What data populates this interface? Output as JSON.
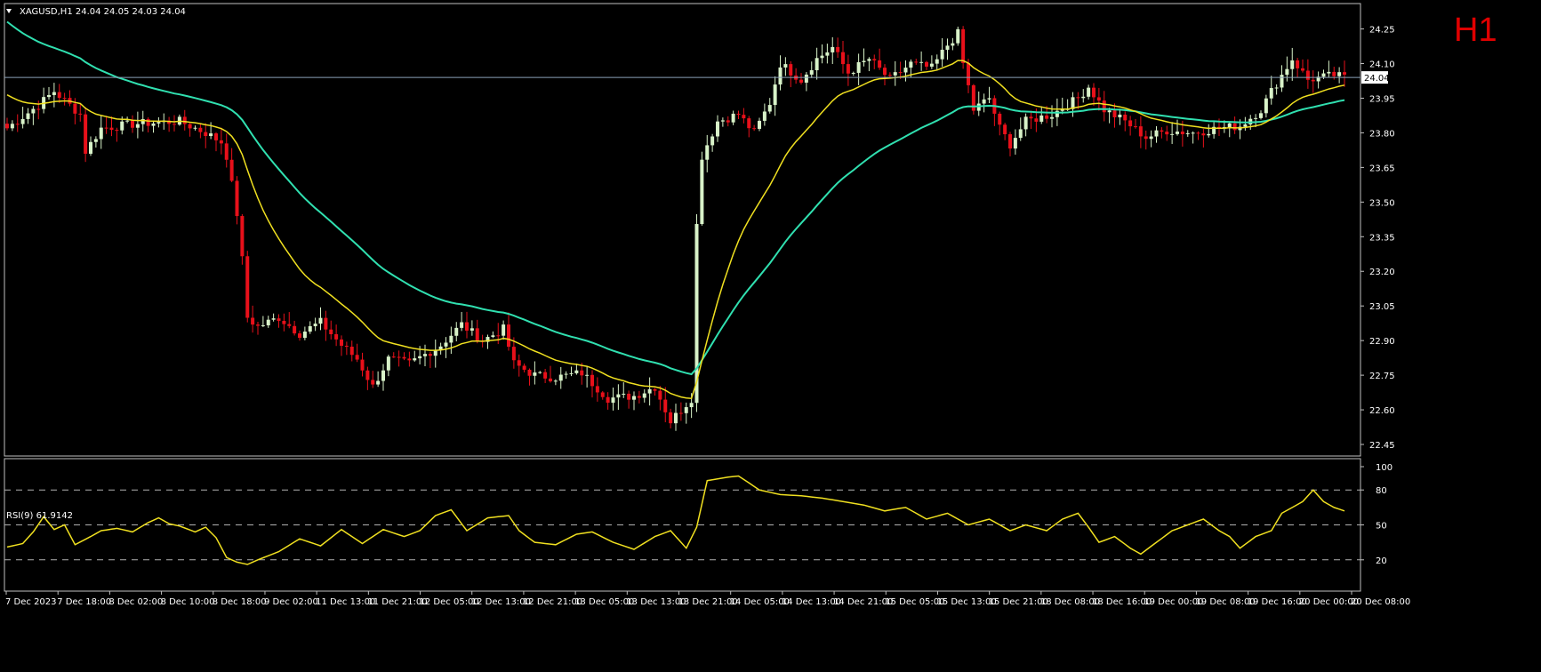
{
  "header": {
    "symbol_line": "XAGUSD,H1  24.04 24.05 24.03 24.04",
    "timeframe": "H1"
  },
  "colors": {
    "background": "#000000",
    "frame": "#c0c0c0",
    "bull_body": "#d8f2c8",
    "bear_body": "#e8101a",
    "ema_fast": "#f0e020",
    "ema_slow": "#30e0b0",
    "rsi_line": "#f0e020",
    "price_line": "#8aa0b8"
  },
  "chart_data": [
    {
      "type": "candlestick",
      "title": "XAGUSD,H1",
      "ylim": [
        22.4,
        24.36
      ],
      "y_ticks": [
        24.25,
        24.1,
        23.95,
        23.8,
        23.65,
        23.5,
        23.35,
        23.2,
        23.05,
        22.9,
        22.75,
        22.6,
        22.45
      ],
      "y_tick_labels": [
        "24.25",
        "24.10",
        "23.95",
        "23.80",
        "23.65",
        "23.50",
        "23.35",
        "23.20",
        "23.05",
        "22.90",
        "22.75",
        "22.60",
        "22.45"
      ],
      "current_price": 24.04,
      "current_price_label": "24.04",
      "x_labels": [
        "7 Dec 2023",
        "7 Dec 18:00",
        "8 Dec 02:00",
        "8 Dec 10:00",
        "8 Dec 18:00",
        "9 Dec 02:00",
        "11 Dec 13:00",
        "11 Dec 21:00",
        "12 Dec 05:00",
        "12 Dec 13:00",
        "12 Dec 21:00",
        "13 Dec 05:00",
        "13 Dec 13:00",
        "13 Dec 21:00",
        "14 Dec 05:00",
        "14 Dec 13:00",
        "14 Dec 21:00",
        "15 Dec 05:00",
        "15 Dec 13:00",
        "15 Dec 21:00",
        "18 Dec 08:00",
        "18 Dec 16:00",
        "19 Dec 00:00",
        "19 Dec 08:00",
        "19 Dec 16:00",
        "20 Dec 00:00",
        "20 Dec 08:00"
      ],
      "key_points": [
        [
          0,
          23.82
        ],
        [
          6,
          23.92
        ],
        [
          9,
          23.98
        ],
        [
          14,
          23.88
        ],
        [
          15,
          23.72
        ],
        [
          18,
          23.82
        ],
        [
          25,
          23.84
        ],
        [
          33,
          23.85
        ],
        [
          38,
          23.8
        ],
        [
          41,
          23.76
        ],
        [
          42,
          23.7
        ],
        [
          44,
          23.45
        ],
        [
          45,
          23.25
        ],
        [
          46,
          23.0
        ],
        [
          48,
          22.96
        ],
        [
          52,
          23.0
        ],
        [
          56,
          22.93
        ],
        [
          60,
          22.98
        ],
        [
          64,
          22.88
        ],
        [
          67,
          22.82
        ],
        [
          70,
          22.7
        ],
        [
          73,
          22.82
        ],
        [
          77,
          22.8
        ],
        [
          83,
          22.88
        ],
        [
          87,
          22.97
        ],
        [
          91,
          22.9
        ],
        [
          95,
          22.95
        ],
        [
          97,
          22.8
        ],
        [
          101,
          22.75
        ],
        [
          105,
          22.74
        ],
        [
          110,
          22.76
        ],
        [
          115,
          22.65
        ],
        [
          120,
          22.66
        ],
        [
          124,
          22.7
        ],
        [
          127,
          22.55
        ],
        [
          129,
          22.6
        ],
        [
          131,
          22.65
        ],
        [
          132,
          23.4
        ],
        [
          133,
          23.7
        ],
        [
          136,
          23.85
        ],
        [
          140,
          23.88
        ],
        [
          143,
          23.8
        ],
        [
          146,
          23.93
        ],
        [
          148,
          24.1
        ],
        [
          152,
          24.03
        ],
        [
          155,
          24.12
        ],
        [
          158,
          24.17
        ],
        [
          161,
          24.06
        ],
        [
          165,
          24.12
        ],
        [
          169,
          24.03
        ],
        [
          173,
          24.1
        ],
        [
          177,
          24.08
        ],
        [
          180,
          24.18
        ],
        [
          182,
          24.23
        ],
        [
          183,
          24.1
        ],
        [
          185,
          23.9
        ],
        [
          188,
          23.95
        ],
        [
          190,
          23.82
        ],
        [
          192,
          23.75
        ],
        [
          195,
          23.85
        ],
        [
          200,
          23.88
        ],
        [
          205,
          23.95
        ],
        [
          207,
          24.0
        ],
        [
          210,
          23.9
        ],
        [
          214,
          23.85
        ],
        [
          218,
          23.78
        ],
        [
          222,
          23.81
        ],
        [
          227,
          23.8
        ],
        [
          232,
          23.82
        ],
        [
          236,
          23.83
        ],
        [
          240,
          23.9
        ],
        [
          242,
          23.98
        ],
        [
          244,
          24.05
        ],
        [
          246,
          24.12
        ],
        [
          249,
          24.03
        ],
        [
          254,
          24.05
        ],
        [
          256,
          24.04
        ]
      ],
      "ema_fast": {
        "period": 20
      },
      "ema_slow": {
        "period": 50
      }
    },
    {
      "type": "line",
      "title": "RSI(9) 61.9142",
      "ylim": [
        0,
        100
      ],
      "y_ticks": [
        100,
        80,
        50,
        20
      ],
      "y_tick_labels": [
        "100",
        "80",
        "50",
        "20"
      ],
      "levels": [
        80,
        50,
        20
      ],
      "key_points": [
        [
          0,
          31
        ],
        [
          3,
          34
        ],
        [
          5,
          44
        ],
        [
          7,
          57
        ],
        [
          9,
          46
        ],
        [
          11,
          50
        ],
        [
          13,
          33
        ],
        [
          16,
          40
        ],
        [
          18,
          45
        ],
        [
          21,
          47
        ],
        [
          24,
          44
        ],
        [
          27,
          52
        ],
        [
          29,
          56
        ],
        [
          31,
          51
        ],
        [
          33,
          49
        ],
        [
          36,
          44
        ],
        [
          38,
          48
        ],
        [
          40,
          39
        ],
        [
          42,
          22
        ],
        [
          44,
          18
        ],
        [
          46,
          16
        ],
        [
          48,
          20
        ],
        [
          52,
          27
        ],
        [
          56,
          38
        ],
        [
          60,
          32
        ],
        [
          64,
          46
        ],
        [
          68,
          34
        ],
        [
          72,
          46
        ],
        [
          76,
          40
        ],
        [
          79,
          45
        ],
        [
          82,
          58
        ],
        [
          85,
          63
        ],
        [
          88,
          45
        ],
        [
          92,
          56
        ],
        [
          96,
          58
        ],
        [
          98,
          45
        ],
        [
          101,
          35
        ],
        [
          105,
          33
        ],
        [
          109,
          42
        ],
        [
          112,
          44
        ],
        [
          116,
          35
        ],
        [
          120,
          29
        ],
        [
          124,
          40
        ],
        [
          127,
          45
        ],
        [
          130,
          30
        ],
        [
          132,
          48
        ],
        [
          134,
          88
        ],
        [
          138,
          91
        ],
        [
          140,
          92
        ],
        [
          142,
          86
        ],
        [
          144,
          80
        ],
        [
          148,
          76
        ],
        [
          152,
          75
        ],
        [
          156,
          73
        ],
        [
          160,
          70
        ],
        [
          164,
          67
        ],
        [
          168,
          62
        ],
        [
          172,
          65
        ],
        [
          176,
          55
        ],
        [
          180,
          60
        ],
        [
          184,
          50
        ],
        [
          188,
          55
        ],
        [
          192,
          45
        ],
        [
          195,
          50
        ],
        [
          199,
          45
        ],
        [
          202,
          55
        ],
        [
          205,
          60
        ],
        [
          207,
          48
        ],
        [
          209,
          35
        ],
        [
          212,
          40
        ],
        [
          215,
          30
        ],
        [
          217,
          25
        ],
        [
          220,
          35
        ],
        [
          223,
          45
        ],
        [
          226,
          50
        ],
        [
          229,
          55
        ],
        [
          232,
          45
        ],
        [
          234,
          40
        ],
        [
          236,
          30
        ],
        [
          239,
          40
        ],
        [
          242,
          45
        ],
        [
          244,
          60
        ],
        [
          246,
          65
        ],
        [
          248,
          70
        ],
        [
          250,
          80
        ],
        [
          252,
          70
        ],
        [
          254,
          65
        ],
        [
          256,
          62
        ]
      ]
    }
  ]
}
